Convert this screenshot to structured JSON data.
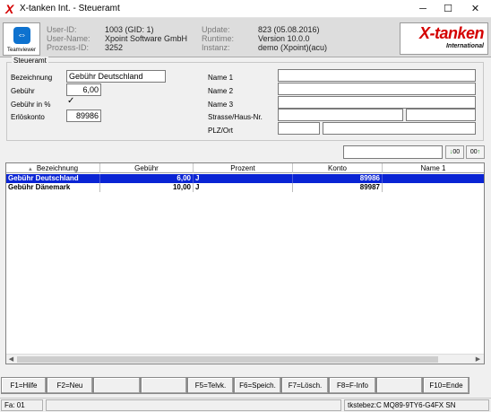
{
  "window": {
    "title": "X-tanken Int. - Steueramt",
    "min_glyph": "─",
    "max_glyph": "☐",
    "close_glyph": "✕"
  },
  "header": {
    "teamviewer_label": "Teamviewer",
    "labels": {
      "user_id": "User-ID:",
      "user_name": "User-Name:",
      "prozess_id": "Prozess-ID:",
      "update": "Update:",
      "runtime": "Runtime:",
      "instanz": "Instanz:"
    },
    "values": {
      "user_id": "1003 (GID: 1)",
      "user_name": "Xpoint Software GmbH",
      "prozess_id": "3252",
      "update": "823 (05.08.2016)",
      "runtime": "Version 10.0.0",
      "instanz": "demo (Xpoint)(acu)"
    },
    "brand_main": "X-tanken",
    "brand_sub": "International"
  },
  "form": {
    "group_title": "Steueramt",
    "labels": {
      "bezeichnung": "Bezeichnung",
      "gebuehr": "Gebühr",
      "gebuehr_prozent": "Gebühr in %",
      "erloeskonto": "Erlöskonto",
      "name1": "Name 1",
      "name2": "Name 2",
      "name3": "Name 3",
      "strasse": "Strasse/Haus-Nr.",
      "plz": "PLZ/Ort"
    },
    "values": {
      "bezeichnung": "Gebühr Deutschland",
      "gebuehr": "6,00",
      "gebuehr_prozent_checked": "✓",
      "erloeskonto": "89986",
      "name1": "",
      "name2": "",
      "name3": "",
      "strasse": "",
      "hausnr": "",
      "plz": "",
      "ort": ""
    }
  },
  "toolbar": {
    "search_value": "",
    "btn1_label": "00",
    "btn2_label": "00"
  },
  "table": {
    "columns": [
      "Bezeichnung",
      "Gebühr",
      "Prozent",
      "Konto",
      "Name 1"
    ],
    "sort_indicator": "▲",
    "rows": [
      {
        "bezeichnung": "Gebühr Deutschland",
        "gebuehr": "6,00",
        "prozent": "J",
        "konto": "89986",
        "name1": ""
      },
      {
        "bezeichnung": "Gebühr Dänemark",
        "gebuehr": "10,00",
        "prozent": "J",
        "konto": "89987",
        "name1": ""
      }
    ],
    "scroll_left": "◀",
    "scroll_right": "▶"
  },
  "fkeys": [
    "F1=Hilfe",
    "F2=Neu",
    "",
    "",
    "F5=Telvk.",
    "F6=Speich.",
    "F7=Lösch.",
    "F8=F-Info",
    "",
    "F10=Ende"
  ],
  "status": {
    "left": "Fa: 01",
    "right": "tkstebez:C MQ89-9TY6-G4FX SN"
  },
  "colors": {
    "selection": "#0a24d4",
    "brand_red": "#d40000",
    "teamviewer_blue": "#0e72cf"
  }
}
